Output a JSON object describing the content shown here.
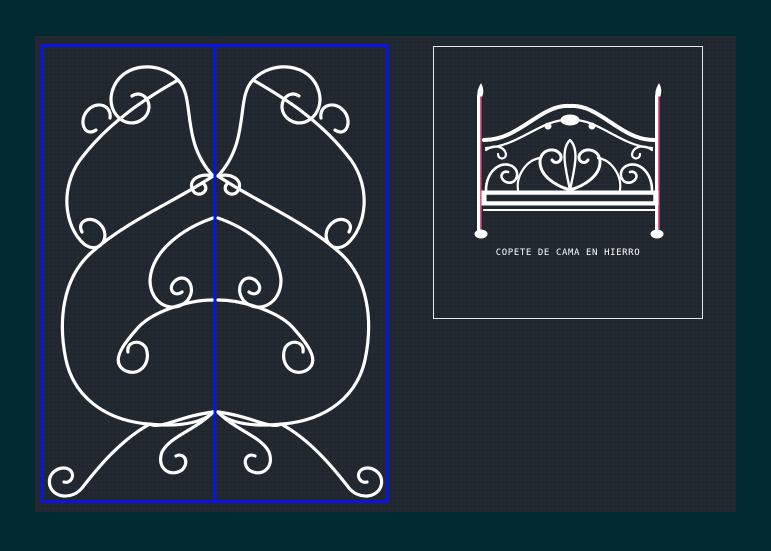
{
  "drawing": {
    "colors": {
      "frame": "#022b31",
      "paper": "#212830",
      "ironwork": "#ffffff",
      "panel_outline": "#0a14e6",
      "post_accent": "#c8386a",
      "label": "#ffffff"
    },
    "left_view": {
      "element": "iron scroll grille, two mirrored panels"
    },
    "right_view": {
      "element": "bed headboard in wrought iron",
      "caption": "COPETE DE CAMA EN HIERRO"
    }
  }
}
